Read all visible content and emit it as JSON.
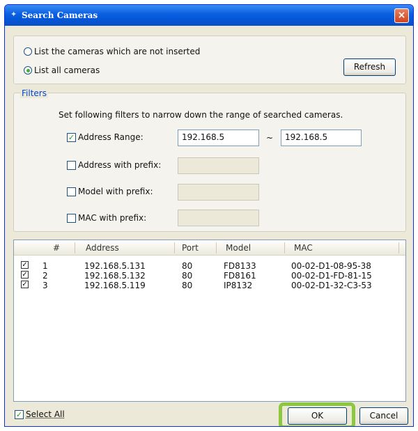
{
  "window": {
    "title": "Search Cameras",
    "close_label": "×",
    "title_icon": "✦"
  },
  "mode": {
    "option_not_inserted": "List the cameras which are not inserted",
    "option_all": "List all cameras",
    "selected": "option_all",
    "refresh_label": "Refresh"
  },
  "filters": {
    "group_title": "Filters",
    "description": "Set following filters to narrow down the range of searched cameras.",
    "address_range": {
      "label": "Address Range:",
      "checked": true,
      "from": "192.168.5",
      "separator": "~",
      "to": "192.168.5"
    },
    "address_prefix": {
      "label": "Address with prefix:",
      "checked": false,
      "value": ""
    },
    "model_prefix": {
      "label": "Model with prefix:",
      "checked": false,
      "value": ""
    },
    "mac_prefix": {
      "label": "MAC with prefix:",
      "checked": false,
      "value": ""
    }
  },
  "table": {
    "columns": [
      "#",
      "Address",
      "Port",
      "Model",
      "MAC"
    ],
    "rows": [
      {
        "checked": true,
        "num": "1",
        "address": "192.168.5.131",
        "port": "80",
        "model": "FD8133",
        "mac": "00-02-D1-08-95-38"
      },
      {
        "checked": true,
        "num": "2",
        "address": "192.168.5.132",
        "port": "80",
        "model": "FD8161",
        "mac": "00-02-D1-FD-81-15"
      },
      {
        "checked": true,
        "num": "3",
        "address": "192.168.5.119",
        "port": "80",
        "model": "IP8132",
        "mac": "00-02-D1-32-C3-53"
      }
    ]
  },
  "footer": {
    "select_all_label": "Select All",
    "select_all_checked": true,
    "ok_label": "OK",
    "cancel_label": "Cancel"
  },
  "colors": {
    "titlebar": "#0a5ee0",
    "highlight": "#8dc63f",
    "group_title": "#0046d5"
  }
}
